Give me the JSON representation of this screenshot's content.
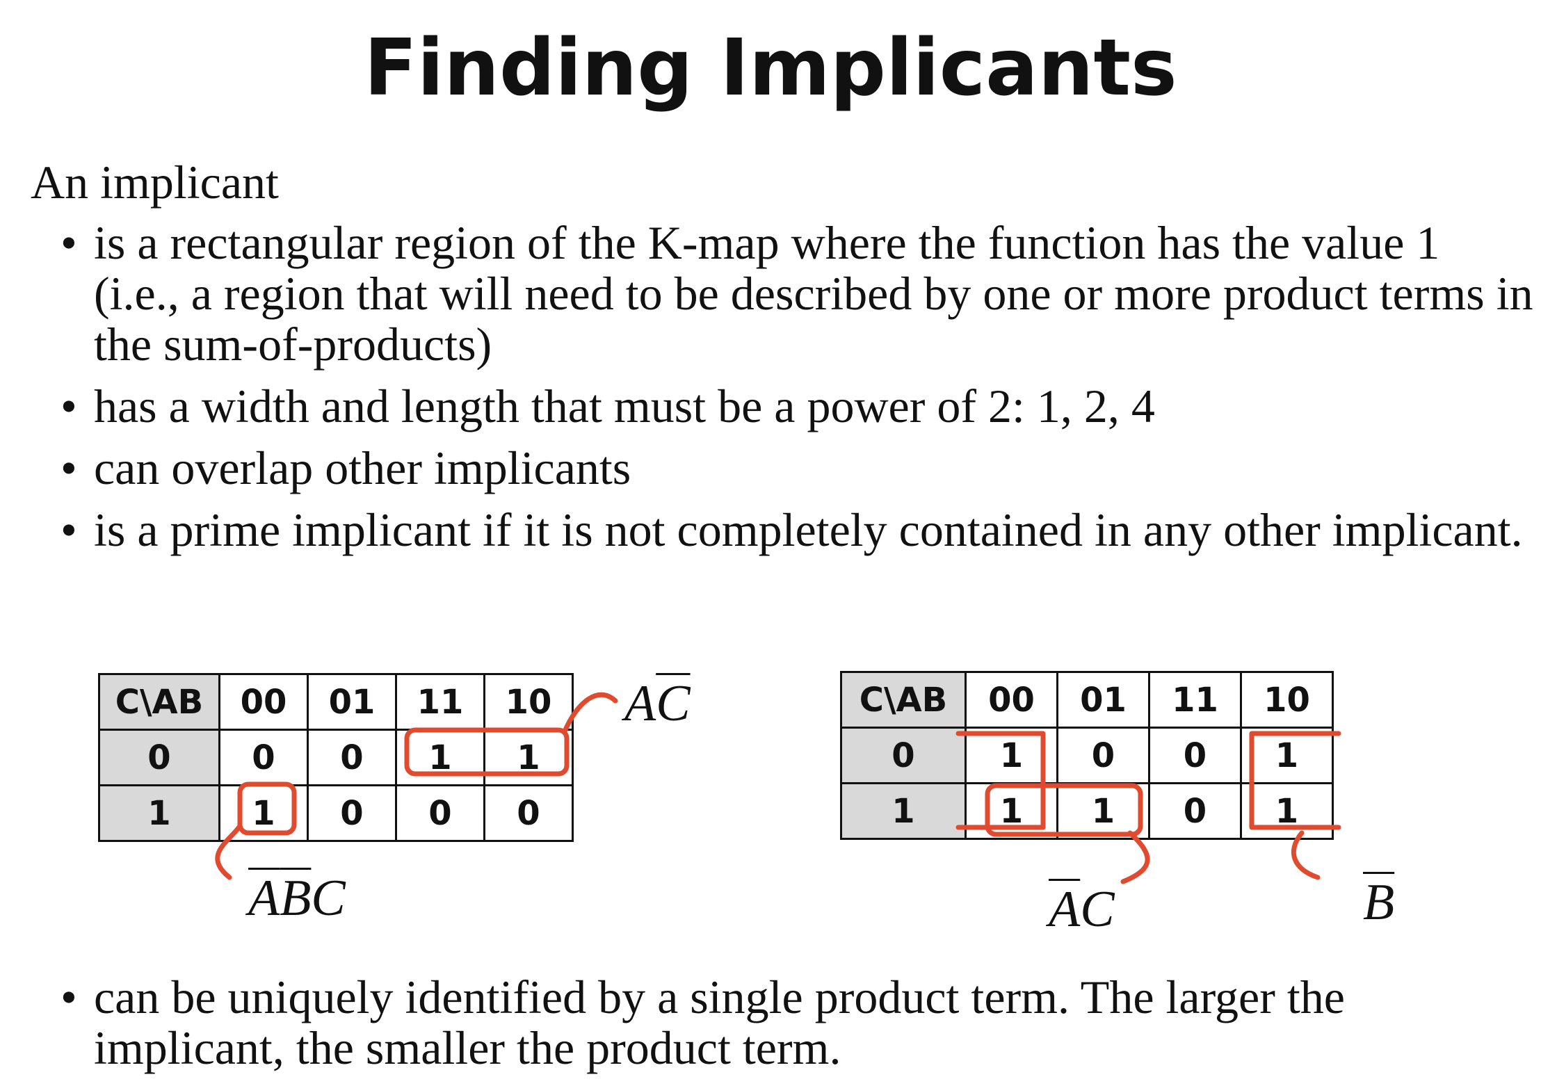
{
  "title": "Finding Implicants",
  "intro": "An implicant",
  "bullet_marker": "•",
  "bullets": [
    "is a rectangular region of the K-map where the function has the value 1 (i.e., a region that will need to be described by one or more product terms in the sum-of-products)",
    "has a width and length that must be a power of 2: 1, 2, 4",
    "can overlap other implicants",
    "is a prime implicant if it is not completely contained in any other implicant.",
    "can be uniquely identified by a single product term.  The larger the implicant, the smaller the product term."
  ],
  "kmap_left": {
    "corner": "C\\AB",
    "columns": [
      "00",
      "01",
      "11",
      "10"
    ],
    "rows": [
      {
        "label": "0",
        "cells": [
          "0",
          "0",
          "1",
          "1"
        ]
      },
      {
        "label": "1",
        "cells": [
          "1",
          "0",
          "0",
          "0"
        ]
      }
    ]
  },
  "kmap_right": {
    "corner": "C\\AB",
    "columns": [
      "00",
      "01",
      "11",
      "10"
    ],
    "rows": [
      {
        "label": "0",
        "cells": [
          "1",
          "0",
          "0",
          "1"
        ]
      },
      {
        "label": "1",
        "cells": [
          "1",
          "1",
          "0",
          "1"
        ]
      }
    ]
  },
  "terms": {
    "left_row": {
      "plain": "A",
      "barred": "C"
    },
    "left_cell": {
      "barred1": "A",
      "barred2": "B",
      "plain": "C"
    },
    "right_pair": {
      "barred": "A",
      "plain": "C"
    },
    "right_col": {
      "barred": "B"
    }
  },
  "colors": {
    "annotation": "#e04a2f",
    "header_fill": "#d9d9d9",
    "text": "#111111"
  }
}
